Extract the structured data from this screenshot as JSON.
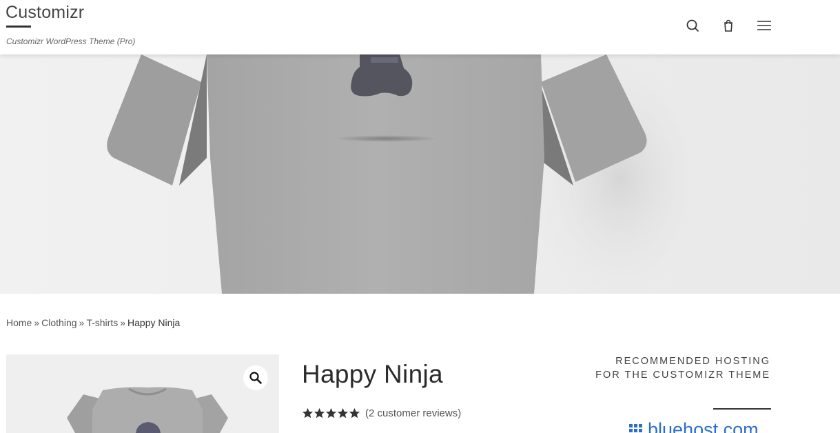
{
  "header": {
    "site_title": "Customizr",
    "tagline": "Customizr WordPress Theme (Pro)",
    "icons": [
      "search-icon",
      "shopping-bag-icon",
      "menu-icon"
    ]
  },
  "hero": {
    "image": "grey-tshirt-with-ninja-print"
  },
  "breadcrumb": {
    "items": [
      "Home",
      "Clothing",
      "T-shirts"
    ],
    "separator": "»",
    "current": "Happy Ninja"
  },
  "product": {
    "title": "Happy Ninja",
    "rating": 5,
    "rating_max": 5,
    "review_link": "(2 customer reviews)",
    "zoom_icon": "magnifier-icon"
  },
  "sidebar": {
    "widget_title": "RECOMMENDED HOSTING FOR THE CUSTOMIZR THEME",
    "logo_text": "bluehost.com"
  },
  "colors": {
    "text": "#333333",
    "accent_blue": "#2d6fc4",
    "hero_bg": "#ececec",
    "shirt": "#a9a9a9"
  }
}
